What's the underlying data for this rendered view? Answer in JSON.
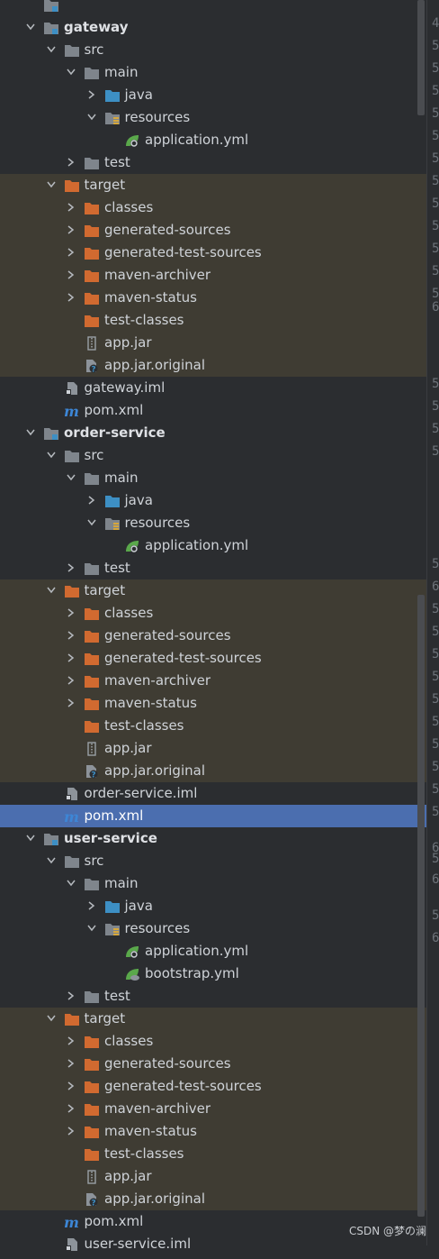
{
  "colors": {
    "background": "#2b2d30",
    "excluded_background": "#3f3c33",
    "selection": "#4b6eaf",
    "folder": "#7f858c",
    "source_folder": "#3d8fc4",
    "excluded_folder": "#d16a30",
    "spring_leaf": "#5aa84b",
    "maven": "#3d86d6"
  },
  "tree": [
    {
      "depth": 0,
      "arrow": "none",
      "icon": "module-folder-icon",
      "label": "",
      "bold": true,
      "excluded": false,
      "selected": false
    },
    {
      "depth": 0,
      "arrow": "down",
      "icon": "module-folder-icon",
      "label": "gateway",
      "bold": true,
      "excluded": false,
      "selected": false
    },
    {
      "depth": 1,
      "arrow": "down",
      "icon": "folder-icon",
      "label": "src",
      "excluded": false,
      "selected": false
    },
    {
      "depth": 2,
      "arrow": "down",
      "icon": "folder-icon",
      "label": "main",
      "excluded": false,
      "selected": false
    },
    {
      "depth": 3,
      "arrow": "right",
      "icon": "source-folder-icon",
      "label": "java",
      "excluded": false,
      "selected": false
    },
    {
      "depth": 3,
      "arrow": "down",
      "icon": "resources-folder-icon",
      "label": "resources",
      "excluded": false,
      "selected": false
    },
    {
      "depth": 4,
      "arrow": "none",
      "icon": "spring-config-icon",
      "label": "application.yml",
      "excluded": false,
      "selected": false
    },
    {
      "depth": 2,
      "arrow": "right",
      "icon": "folder-icon",
      "label": "test",
      "excluded": false,
      "selected": false
    },
    {
      "depth": 1,
      "arrow": "down",
      "icon": "excluded-folder-icon",
      "label": "target",
      "excluded": true,
      "selected": false
    },
    {
      "depth": 2,
      "arrow": "right",
      "icon": "excluded-folder-icon",
      "label": "classes",
      "excluded": true,
      "selected": false
    },
    {
      "depth": 2,
      "arrow": "right",
      "icon": "excluded-folder-icon",
      "label": "generated-sources",
      "excluded": true,
      "selected": false
    },
    {
      "depth": 2,
      "arrow": "right",
      "icon": "excluded-folder-icon",
      "label": "generated-test-sources",
      "excluded": true,
      "selected": false
    },
    {
      "depth": 2,
      "arrow": "right",
      "icon": "excluded-folder-icon",
      "label": "maven-archiver",
      "excluded": true,
      "selected": false
    },
    {
      "depth": 2,
      "arrow": "right",
      "icon": "excluded-folder-icon",
      "label": "maven-status",
      "excluded": true,
      "selected": false
    },
    {
      "depth": 2,
      "arrow": "none",
      "icon": "excluded-folder-icon",
      "label": "test-classes",
      "excluded": true,
      "selected": false
    },
    {
      "depth": 2,
      "arrow": "none",
      "icon": "jar-icon",
      "label": "app.jar",
      "excluded": true,
      "selected": false
    },
    {
      "depth": 2,
      "arrow": "none",
      "icon": "unknown-file-icon",
      "label": "app.jar.original",
      "excluded": true,
      "selected": false
    },
    {
      "depth": 1,
      "arrow": "none",
      "icon": "iml-file-icon",
      "label": "gateway.iml",
      "excluded": false,
      "selected": false
    },
    {
      "depth": 1,
      "arrow": "none",
      "icon": "maven-icon",
      "label": "pom.xml",
      "excluded": false,
      "selected": false
    },
    {
      "depth": 0,
      "arrow": "down",
      "icon": "module-folder-icon",
      "label": "order-service",
      "bold": true,
      "excluded": false,
      "selected": false
    },
    {
      "depth": 1,
      "arrow": "down",
      "icon": "folder-icon",
      "label": "src",
      "excluded": false,
      "selected": false
    },
    {
      "depth": 2,
      "arrow": "down",
      "icon": "folder-icon",
      "label": "main",
      "excluded": false,
      "selected": false
    },
    {
      "depth": 3,
      "arrow": "right",
      "icon": "source-folder-icon",
      "label": "java",
      "excluded": false,
      "selected": false
    },
    {
      "depth": 3,
      "arrow": "down",
      "icon": "resources-folder-icon",
      "label": "resources",
      "excluded": false,
      "selected": false
    },
    {
      "depth": 4,
      "arrow": "none",
      "icon": "spring-config-icon",
      "label": "application.yml",
      "excluded": false,
      "selected": false
    },
    {
      "depth": 2,
      "arrow": "right",
      "icon": "folder-icon",
      "label": "test",
      "excluded": false,
      "selected": false
    },
    {
      "depth": 1,
      "arrow": "down",
      "icon": "excluded-folder-icon",
      "label": "target",
      "excluded": true,
      "selected": false
    },
    {
      "depth": 2,
      "arrow": "right",
      "icon": "excluded-folder-icon",
      "label": "classes",
      "excluded": true,
      "selected": false
    },
    {
      "depth": 2,
      "arrow": "right",
      "icon": "excluded-folder-icon",
      "label": "generated-sources",
      "excluded": true,
      "selected": false
    },
    {
      "depth": 2,
      "arrow": "right",
      "icon": "excluded-folder-icon",
      "label": "generated-test-sources",
      "excluded": true,
      "selected": false
    },
    {
      "depth": 2,
      "arrow": "right",
      "icon": "excluded-folder-icon",
      "label": "maven-archiver",
      "excluded": true,
      "selected": false
    },
    {
      "depth": 2,
      "arrow": "right",
      "icon": "excluded-folder-icon",
      "label": "maven-status",
      "excluded": true,
      "selected": false
    },
    {
      "depth": 2,
      "arrow": "none",
      "icon": "excluded-folder-icon",
      "label": "test-classes",
      "excluded": true,
      "selected": false
    },
    {
      "depth": 2,
      "arrow": "none",
      "icon": "jar-icon",
      "label": "app.jar",
      "excluded": true,
      "selected": false
    },
    {
      "depth": 2,
      "arrow": "none",
      "icon": "unknown-file-icon",
      "label": "app.jar.original",
      "excluded": true,
      "selected": false
    },
    {
      "depth": 1,
      "arrow": "none",
      "icon": "iml-file-icon",
      "label": "order-service.iml",
      "excluded": false,
      "selected": false
    },
    {
      "depth": 1,
      "arrow": "none",
      "icon": "maven-icon",
      "label": "pom.xml",
      "excluded": false,
      "selected": true
    },
    {
      "depth": 0,
      "arrow": "down",
      "icon": "module-folder-icon",
      "label": "user-service",
      "bold": true,
      "excluded": false,
      "selected": false
    },
    {
      "depth": 1,
      "arrow": "down",
      "icon": "folder-icon",
      "label": "src",
      "excluded": false,
      "selected": false
    },
    {
      "depth": 2,
      "arrow": "down",
      "icon": "folder-icon",
      "label": "main",
      "excluded": false,
      "selected": false
    },
    {
      "depth": 3,
      "arrow": "right",
      "icon": "source-folder-icon",
      "label": "java",
      "excluded": false,
      "selected": false
    },
    {
      "depth": 3,
      "arrow": "down",
      "icon": "resources-folder-icon",
      "label": "resources",
      "excluded": false,
      "selected": false
    },
    {
      "depth": 4,
      "arrow": "none",
      "icon": "spring-config-icon",
      "label": "application.yml",
      "excluded": false,
      "selected": false
    },
    {
      "depth": 4,
      "arrow": "none",
      "icon": "spring-leaf-icon",
      "label": "bootstrap.yml",
      "excluded": false,
      "selected": false
    },
    {
      "depth": 2,
      "arrow": "right",
      "icon": "folder-icon",
      "label": "test",
      "excluded": false,
      "selected": false
    },
    {
      "depth": 1,
      "arrow": "down",
      "icon": "excluded-folder-icon",
      "label": "target",
      "excluded": true,
      "selected": false
    },
    {
      "depth": 2,
      "arrow": "right",
      "icon": "excluded-folder-icon",
      "label": "classes",
      "excluded": true,
      "selected": false
    },
    {
      "depth": 2,
      "arrow": "right",
      "icon": "excluded-folder-icon",
      "label": "generated-sources",
      "excluded": true,
      "selected": false
    },
    {
      "depth": 2,
      "arrow": "right",
      "icon": "excluded-folder-icon",
      "label": "generated-test-sources",
      "excluded": true,
      "selected": false
    },
    {
      "depth": 2,
      "arrow": "right",
      "icon": "excluded-folder-icon",
      "label": "maven-archiver",
      "excluded": true,
      "selected": false
    },
    {
      "depth": 2,
      "arrow": "right",
      "icon": "excluded-folder-icon",
      "label": "maven-status",
      "excluded": true,
      "selected": false
    },
    {
      "depth": 2,
      "arrow": "none",
      "icon": "excluded-folder-icon",
      "label": "test-classes",
      "excluded": true,
      "selected": false
    },
    {
      "depth": 2,
      "arrow": "none",
      "icon": "jar-icon",
      "label": "app.jar",
      "excluded": true,
      "selected": false
    },
    {
      "depth": 2,
      "arrow": "none",
      "icon": "unknown-file-icon",
      "label": "app.jar.original",
      "excluded": true,
      "selected": false
    },
    {
      "depth": 1,
      "arrow": "none",
      "icon": "maven-icon",
      "label": "pom.xml",
      "excluded": false,
      "selected": false
    },
    {
      "depth": 1,
      "arrow": "none",
      "icon": "iml-file-icon",
      "label": "user-service.iml",
      "excluded": false,
      "selected": false
    }
  ],
  "gutter": [
    "4",
    "5",
    "5",
    "5",
    "5",
    "5",
    "5",
    "5",
    "5",
    "5",
    "5",
    "5",
    "5",
    "6",
    "",
    "",
    "5",
    "5",
    "5",
    "5",
    "",
    "",
    "",
    "",
    "5",
    "6",
    "5",
    "5",
    "5",
    "5",
    "5",
    "5",
    "5",
    "5",
    "5",
    "5",
    "6",
    "5",
    "6",
    "5",
    "6"
  ],
  "watermark": "CSDN @梦の澜"
}
